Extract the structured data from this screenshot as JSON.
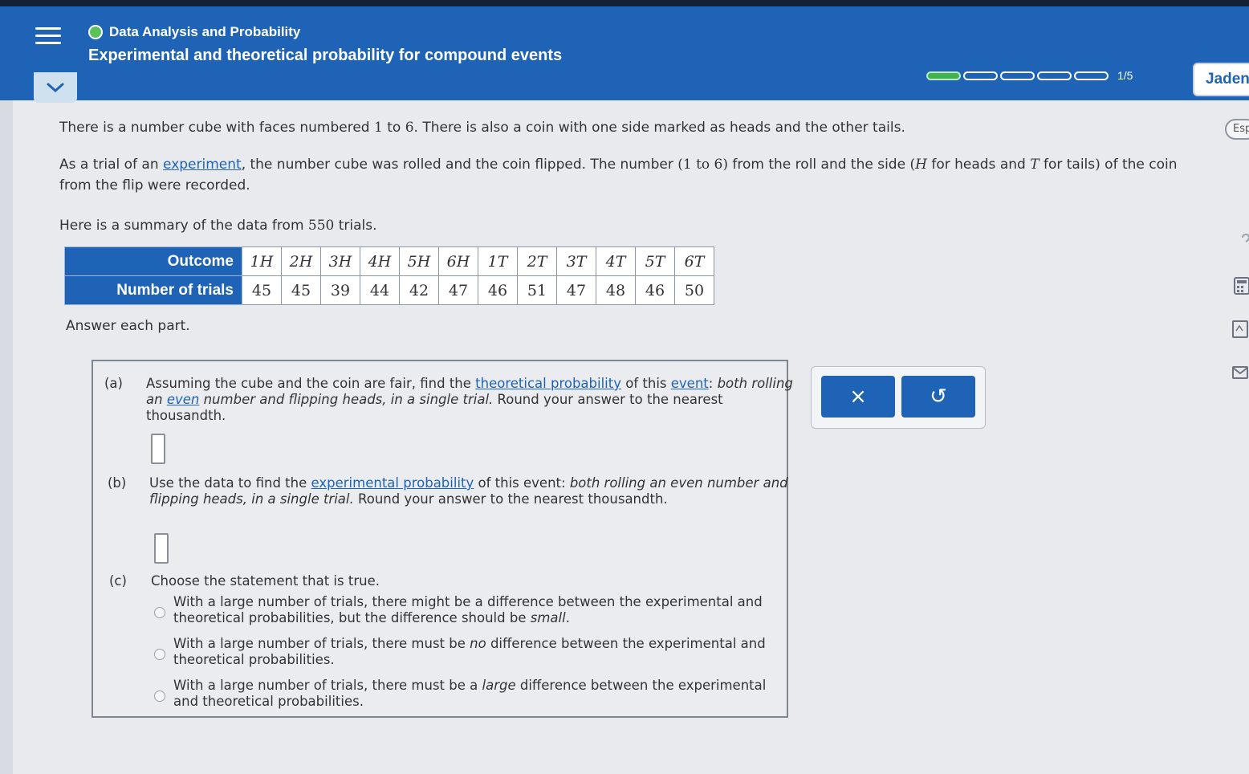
{
  "header": {
    "subject": "Data Analysis and Probability",
    "topic": "Experimental and theoretical probability for compound events",
    "progress_text": "1/5",
    "progress_fraction": 0.2,
    "user_name": "Jaden",
    "language_button": "Esp"
  },
  "problem": {
    "p1": [
      "There is a number cube with faces numbered ",
      "1",
      " to ",
      "6",
      ". There is also a coin with one side marked as heads and the other tails."
    ],
    "p2": [
      "As a trial of an ",
      "experiment",
      ", the number cube was rolled and the coin flipped. The number ",
      "(1 to 6)",
      " from the roll and the side ",
      "(",
      "H",
      " for heads and ",
      "T",
      " for tails",
      ")",
      " of the coin from the flip were recorded."
    ],
    "p3": [
      "Here is a summary of the data from ",
      "550",
      " trials."
    ],
    "table": {
      "row1_header": "Outcome",
      "row2_header": "Number of trials",
      "outcomes": [
        "1H",
        "2H",
        "3H",
        "4H",
        "5H",
        "6H",
        "1T",
        "2T",
        "3T",
        "4T",
        "5T",
        "6T"
      ],
      "counts": [
        "45",
        "45",
        "39",
        "44",
        "42",
        "47",
        "46",
        "51",
        "47",
        "48",
        "46",
        "50"
      ]
    },
    "answer_each": "Answer each part."
  },
  "parts": {
    "a": {
      "label": "(a)",
      "segments": [
        "Assuming the cube and the coin are fair, find the ",
        "theoretical probability",
        " of this ",
        "event",
        ": ",
        "both rolling an ",
        "even",
        " number and flipping heads, in a single trial.",
        " Round your answer to the nearest thousandth."
      ],
      "value": ""
    },
    "b": {
      "label": "(b)",
      "segments": [
        "Use the data to find the ",
        "experimental probability",
        " of this event: ",
        "both rolling an even number and flipping heads, in a single trial.",
        " Round your answer to the nearest thousandth."
      ],
      "value": ""
    },
    "c": {
      "label": "(c)",
      "prompt": "Choose the statement that is true.",
      "options": [
        [
          "With a large number of trials, there might be a difference between the experimental and theoretical probabilities, but the difference should be ",
          "small",
          "."
        ],
        [
          "With a large number of trials, there must be ",
          "no",
          " difference between the experimental and theoretical probabilities."
        ],
        [
          "With a large number of trials, there must be a ",
          "large",
          " difference between the experimental and theoretical probabilities."
        ]
      ]
    }
  },
  "actions": {
    "clear": "×",
    "undo": "↺"
  },
  "colors": {
    "primary": "#1e63b5",
    "progress": "#3fb34f",
    "status_dot": "#5cc15a"
  },
  "icons": [
    "menu-icon",
    "chevron-down-icon",
    "question-icon",
    "calculator-icon",
    "book-icon",
    "mail-icon"
  ]
}
